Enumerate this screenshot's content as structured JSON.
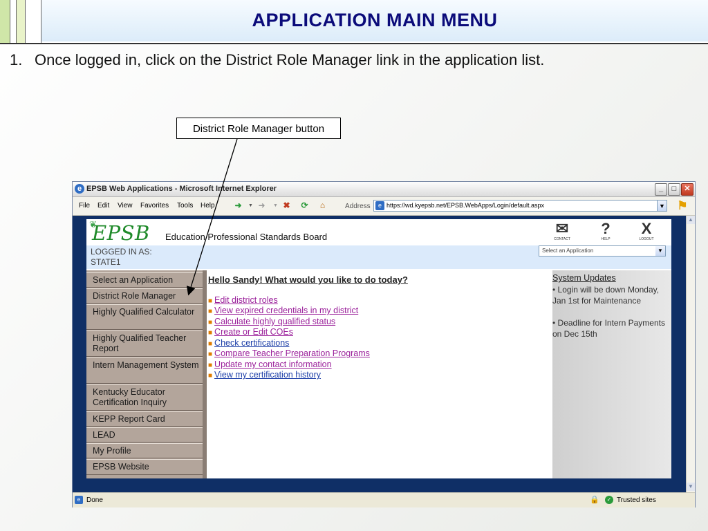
{
  "slide": {
    "title": "APPLICATION MAIN MENU",
    "instruction_number": "1.",
    "instruction_text": "Once logged in, click on the District Role Manager link in the application list.",
    "callout": "District Role Manager button"
  },
  "colors": {
    "title": "#0b0b7a",
    "nav_bg": "#b3a59b",
    "content_bg": "#0f2f66",
    "visited_link": "#9a1f9a",
    "link": "#1d3fa8"
  },
  "browser": {
    "window_title": "EPSB Web Applications - Microsoft Internet Explorer",
    "menu": [
      "File",
      "Edit",
      "View",
      "Favorites",
      "Tools",
      "Help"
    ],
    "address_label": "Address",
    "address_url": "https://wd.kyepsb.net/EPSB.WebApps/Login/default.aspx",
    "status_text": "Done",
    "zone_text": "Trusted sites",
    "toolbar_icons": [
      "back-icon",
      "forward-icon",
      "stop-icon",
      "refresh-icon",
      "home-icon"
    ]
  },
  "site": {
    "logo": "EPSB",
    "org_name": "Education Professional Standards Board",
    "header_icons": [
      {
        "label": "CONTACT",
        "icon": "envelope-icon"
      },
      {
        "label": "HELP",
        "icon": "question-icon"
      },
      {
        "label": "LOGOUT",
        "icon": "x-icon"
      }
    ],
    "logged_in_label": "LOGGED IN AS:",
    "logged_in_user": "STATE1",
    "app_select_value": "Select an Application",
    "nav": [
      "Select an Application",
      "District Role Manager",
      "Highly Qualified Calculator",
      "Highly Qualified Teacher Report",
      "Intern Management System",
      "Kentucky Educator Certification Inquiry",
      "KEPP Report Card",
      "LEAD",
      "My Profile",
      "EPSB Website"
    ],
    "greeting": "Hello Sandy!   What would you like to do today?",
    "links": [
      {
        "text": "Edit district roles",
        "visited": true
      },
      {
        "text": "View expired credentials in my district",
        "visited": true
      },
      {
        "text": "Calculate highly qualified status",
        "visited": true
      },
      {
        "text": "Create or Edit COEs",
        "visited": true
      },
      {
        "text": "Check certifications",
        "visited": false
      },
      {
        "text": "Compare Teacher Preparation Programs",
        "visited": true
      },
      {
        "text": "Update my contact information",
        "visited": true
      },
      {
        "text": "View my certification history",
        "visited": false
      }
    ],
    "updates_title": "System Updates",
    "updates": [
      "Login will be down Monday, Jan 1st for Maintenance",
      "Deadline for Intern Payments on Dec 15th"
    ]
  }
}
